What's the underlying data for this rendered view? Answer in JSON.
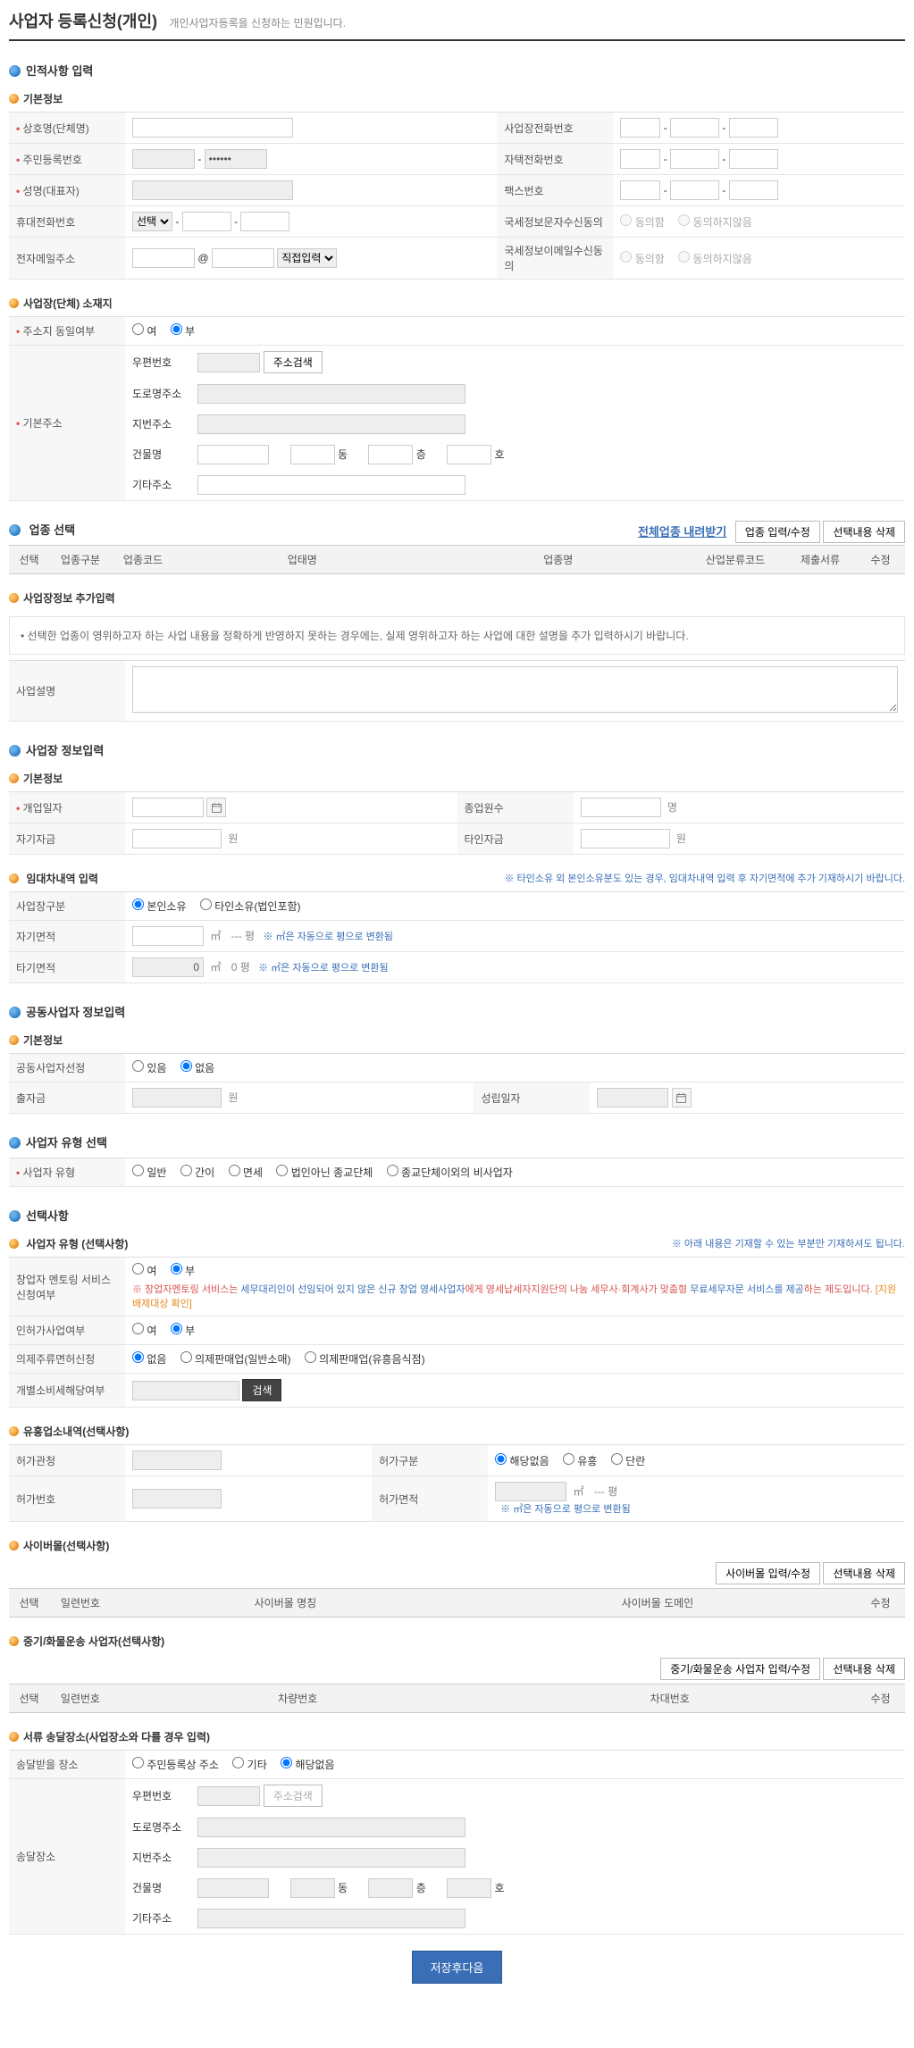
{
  "page": {
    "title": "사업자 등록신청(개인)",
    "subtitle": "개인사업자등록을 신청하는 민원입니다."
  },
  "sections": {
    "personal": "인적사항 입력",
    "basic": "기본정보",
    "location": "사업장(단체) 소재지",
    "biztype": "업종 선택",
    "extra": "사업장정보 추가입력",
    "bizinfo": "사업장 정보입력",
    "lease": "임대차내역 입력",
    "joint": "공동사업자 정보입력",
    "owner": "사업자 유형 선택",
    "optional": "선택사항",
    "owner_opt": "사업자 유형 (선택사항)",
    "liquor": "유흥업소내역(선택사항)",
    "cyber": "사이버몰(선택사항)",
    "vehicle": "중기/화물운송 사업자(선택사항)",
    "delivery": "서류 송달장소(사업장소와 다를 경우 입력)"
  },
  "labels": {
    "bizname": "상호명(단체명)",
    "rrn": "주민등록번호",
    "name": "성명(대표자)",
    "mobile": "휴대전화번호",
    "email": "전자메일주소",
    "biztel": "사업장전화번호",
    "hometl": "자택전화번호",
    "fax": "팩스번호",
    "sms": "국세정보문자수신동의",
    "mail": "국세정보이메일수신동의",
    "sameaddr": "주소지 동일여부",
    "baseaddr": "기본주소",
    "zip": "우편번호",
    "road": "도로명주소",
    "lot": "지번주소",
    "bldg": "건물명",
    "etcaddr": "기타주소",
    "dong": "동",
    "floor": "층",
    "ho": "호",
    "search": "주소검색",
    "downall": "전체업종 내려받기",
    "add_edit": "업종 입력/수정",
    "del_sel": "선택내용 삭제",
    "bizdesc": "사업설명",
    "open": "개업일자",
    "emp": "종업원수",
    "self_fund": "자기자금",
    "other_fund": "타인자금",
    "won": "원",
    "myon": "명",
    "biz_cat": "사업장구분",
    "self_area": "자기면적",
    "other_area": "타기면적",
    "m2": "㎡",
    "pyong": "평",
    "area_hint": "※ ㎡은 자동으로 평으로 변환됨",
    "joint_apply": "공동사업자선정",
    "contrib": "출자금",
    "est_date": "성립일자",
    "owner_type": "사업자 유형",
    "general": "일반",
    "simple": "간이",
    "exempt": "면세",
    "corp_rel": "법인아닌 종교단체",
    "non_rel": "종교단체이외의 비사업자",
    "mentoring": "창업자 멘토링 서비스 신청여부",
    "indep": "인허가사업여부",
    "liquor_perm": "의제주류면허신청",
    "indiv_tax": "개별소비세해당여부",
    "search_btn": "검색",
    "liq_none": "없음",
    "liq_gen": "의제판매업(일반소매)",
    "liq_ent": "의제판매업(유흥음식점)",
    "perm_office": "허가관청",
    "perm_type": "허가구분",
    "perm_no": "허가번호",
    "perm_area": "허가면적",
    "none": "해당없음",
    "yes": "유흥",
    "no_t": "단란",
    "cyber_add": "사이버몰 입력/수정",
    "vehicle_add": "중기/화물운송 사업자 입력/수정",
    "recv_loc": "송달받을 장소",
    "send_loc": "송달장소",
    "rrn_addr": "주민등록상 주소",
    "other": "기타",
    "agree": "동의함",
    "disagree": "동의하지않음",
    "yes_r": "여",
    "no_r": "부",
    "exist": "있음",
    "none_r": "없음",
    "own_self": "본인소유",
    "own_other": "타인소유(법인포함)",
    "select": "선택",
    "direct": "직접입력",
    "submit": "저장후다음"
  },
  "values": {
    "rrn_masked": "••••••",
    "other_area": "0",
    "other_pyong": "0 평"
  },
  "notes": {
    "extra": "• 선택한 업종이 영위하고자 하는 사업 내용을 정확하게 반영하지 못하는 경우에는, 실제 영위하고자 하는 사업에 대한 설명을 추가 입력하시기 바랍니다.",
    "lease": "※ 타인소유 외 본인소유분도 있는 경우, 임대차내역 입력 후 자기면적에 추가 기재하시기 바랍니다.",
    "optional": "※ 아래 내용은 기재할 수 있는 부분만 기재하셔도 됩니다.",
    "mentor1": "※ 창업자멘토링 서비스는 ",
    "mentor1b": "세무대리인이 선임되어 있지 않은 신규 창업 영세사업자",
    "mentor1c": "에게 영세납세자지원단의 나눔 세무사·회계사가 맞춤형 ",
    "mentor1d": "무료세무자문 서비스를 제공",
    "mentor1e": "하는 제도입니다. ",
    "mentor1f": "[지원배제대상 확인]"
  },
  "grids": {
    "biz": [
      "선택",
      "업종구분",
      "업종코드",
      "업태명",
      "업종명",
      "산업분류코드",
      "제출서류",
      "수정"
    ],
    "cyber": [
      "선택",
      "일련번호",
      "사이버몰 명칭",
      "사이버몰 도메인",
      "수정"
    ],
    "vehicle": [
      "선택",
      "일련번호",
      "차량번호",
      "차대번호",
      "수정"
    ]
  }
}
